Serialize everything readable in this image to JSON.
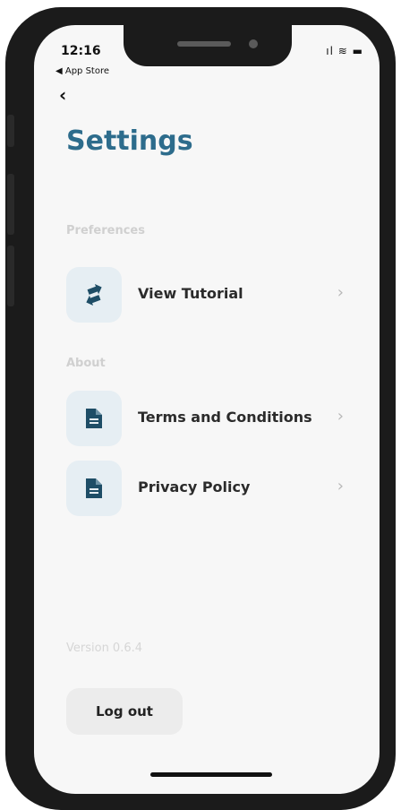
{
  "status": {
    "time": "12:16",
    "back_app": "◀ App Store",
    "icons": "ıl ≋ ▬"
  },
  "nav": {
    "back_glyph": "‹"
  },
  "page": {
    "title": "Settings"
  },
  "sections": {
    "preferences": "Preferences",
    "about": "About"
  },
  "items": [
    {
      "label": "View Tutorial",
      "icon": "exchange-icon"
    },
    {
      "label": "Terms and Conditions",
      "icon": "document-icon"
    },
    {
      "label": "Privacy Policy",
      "icon": "document-icon"
    }
  ],
  "chevron": "›",
  "version": "Version 0.6.4",
  "logout_label": "Log out",
  "colors": {
    "accent": "#2d6c8c",
    "icon_bg": "#e6eef3",
    "icon_fg": "#1e4d66"
  }
}
